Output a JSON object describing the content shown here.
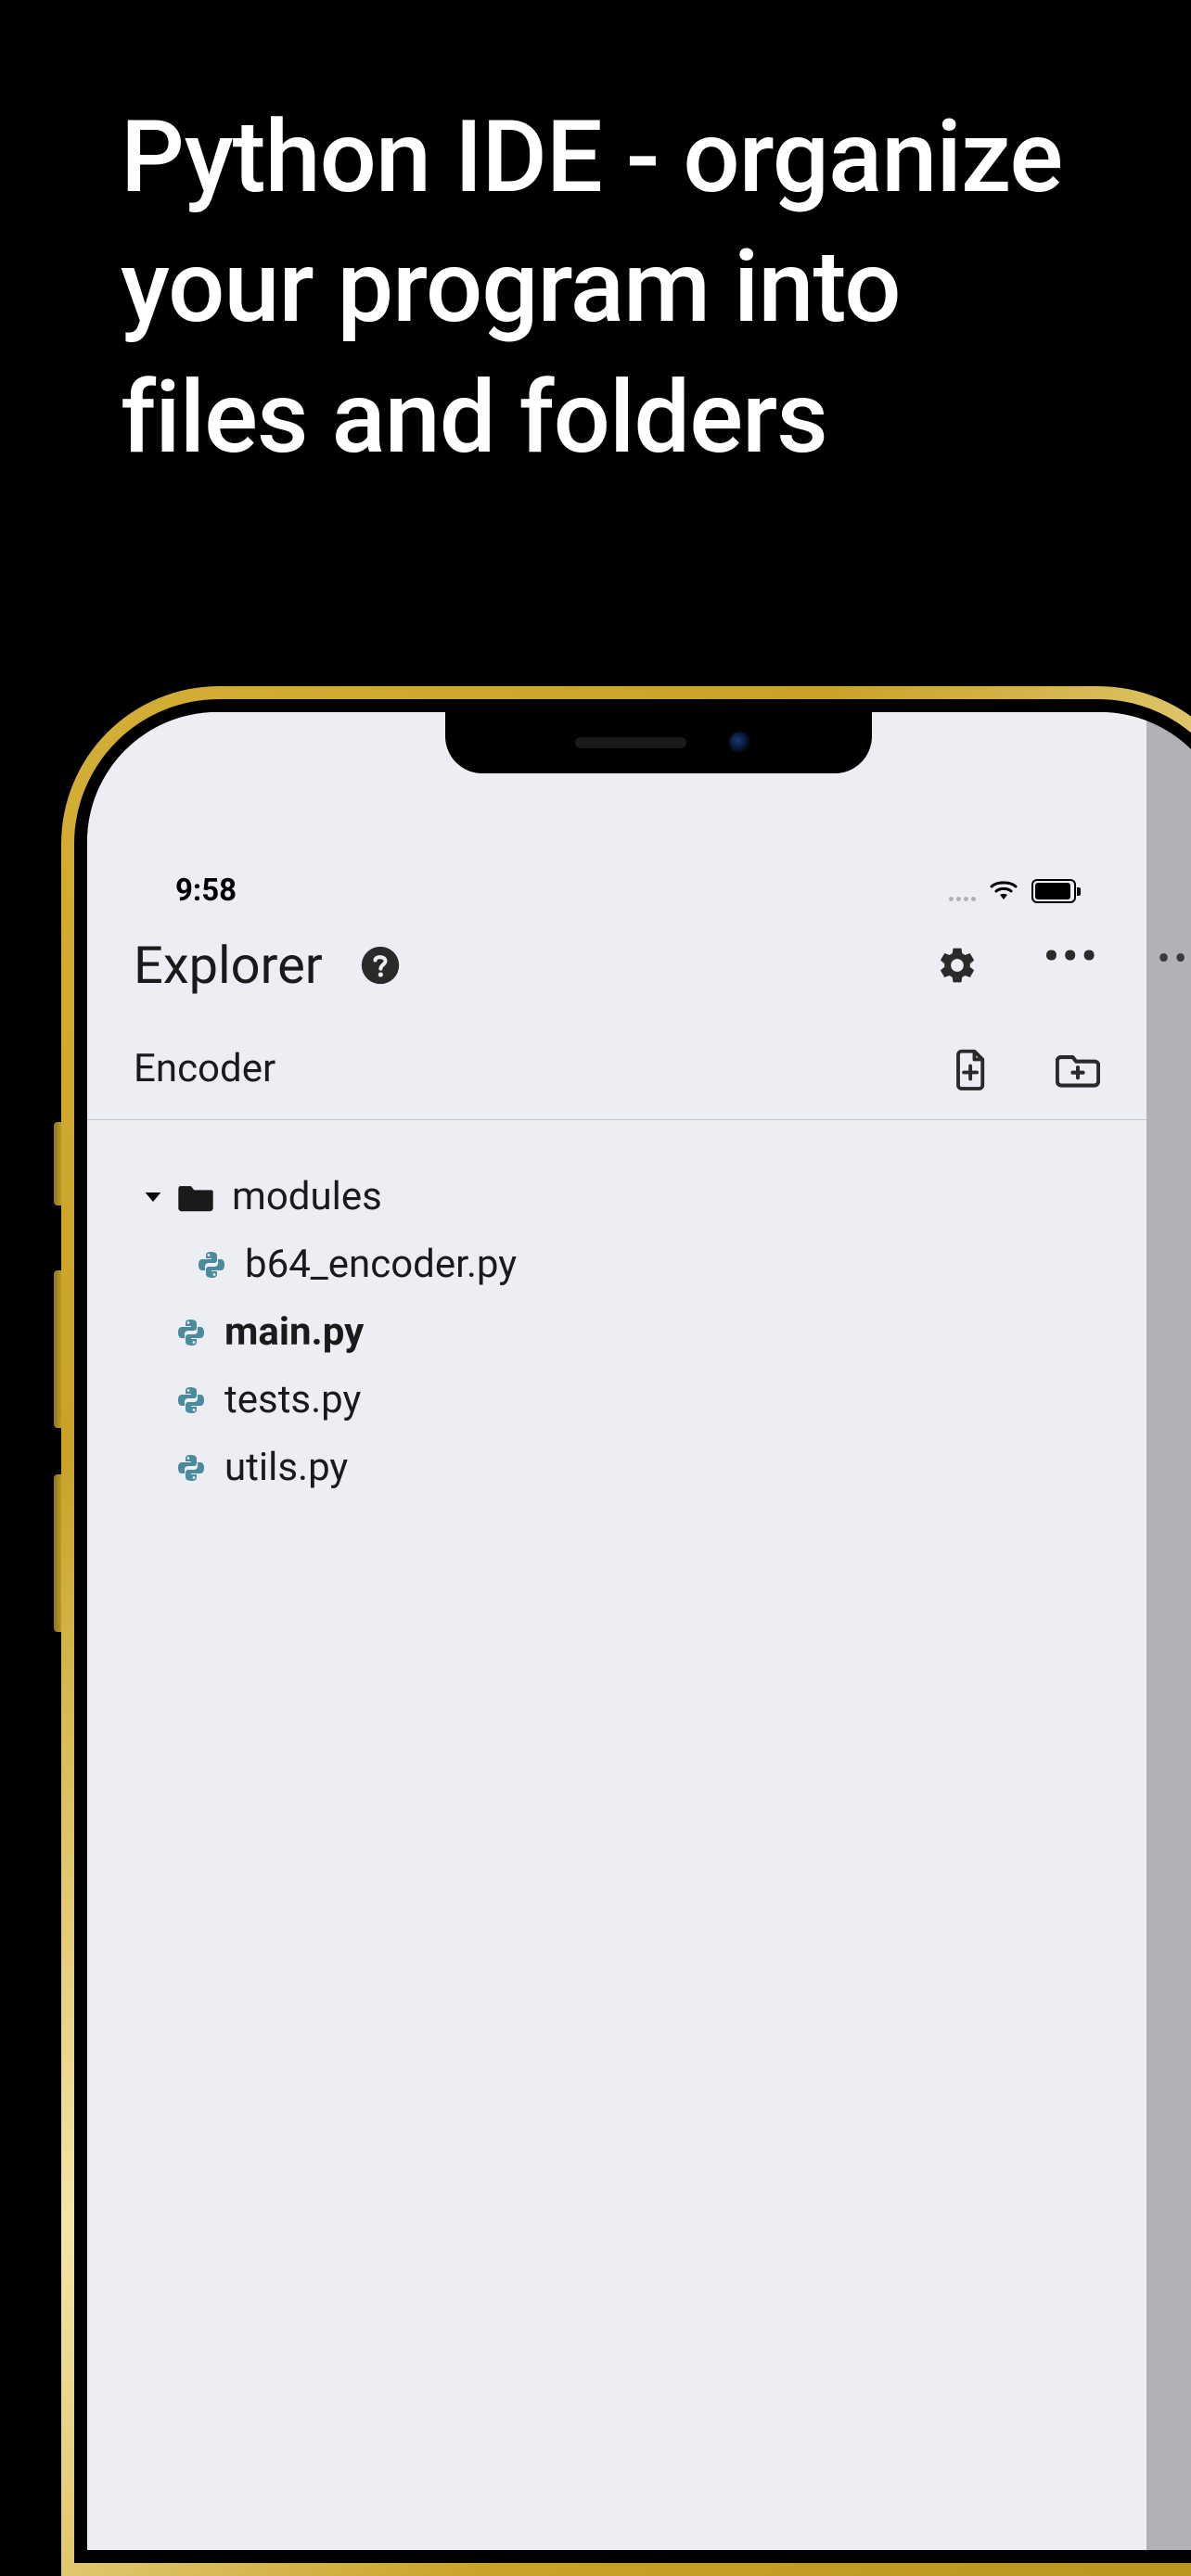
{
  "headline": "Python IDE - organize your program into files and folders",
  "status": {
    "time": "9:58"
  },
  "explorer": {
    "title": "Explorer",
    "project_name": "Encoder",
    "tree": {
      "folder_name": "modules",
      "folder_child": "b64_encoder.py",
      "file_main": "main.py",
      "file_tests": "tests.py",
      "file_utils": "utils.py"
    }
  },
  "colors": {
    "bg": "#edeef4",
    "icon_dark": "#2a2a2a",
    "python_blue": "#3c7bb0",
    "python_teal": "#4b8b9e"
  }
}
